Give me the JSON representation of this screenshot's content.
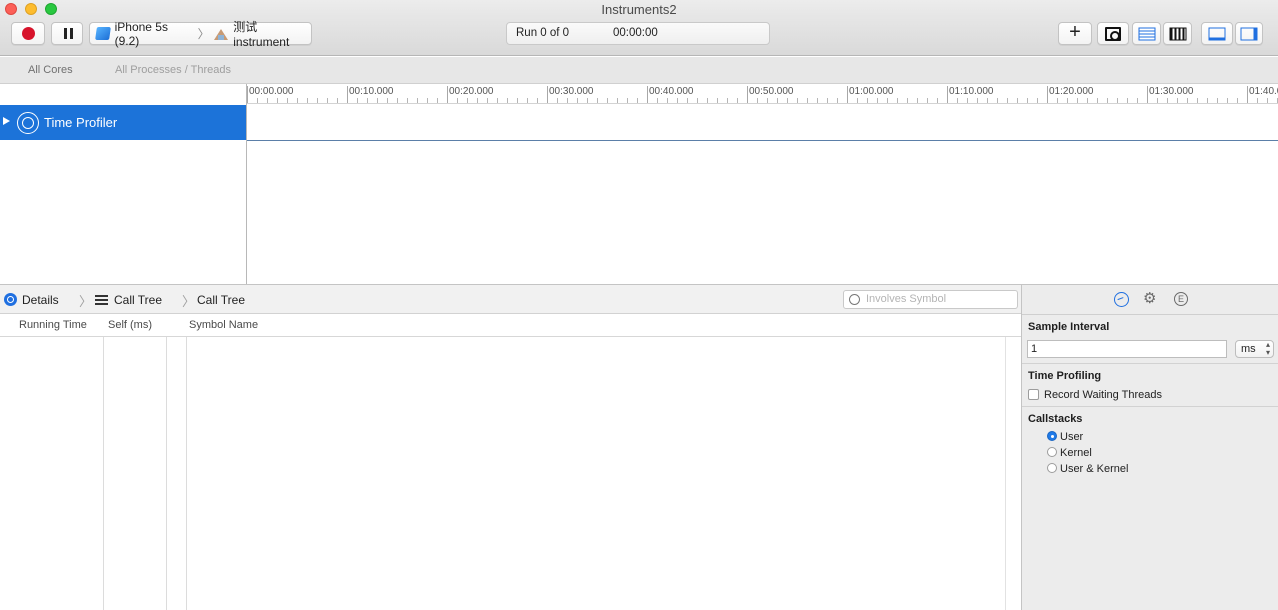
{
  "window": {
    "title": "Instruments2"
  },
  "toolbar": {
    "device": "iPhone 5s (9.2)",
    "target": "测试instrument",
    "run_label": "Run 0 of 0",
    "elapsed": "00:00:00",
    "add_label": "+"
  },
  "filter": {
    "cores": "All Cores",
    "processes": "All Processes / Threads"
  },
  "timeline": {
    "ticks": [
      "00:00.000",
      "00:10.000",
      "00:20.000",
      "00:30.000",
      "00:40.000",
      "00:50.000",
      "01:00.000",
      "01:10.000",
      "01:20.000",
      "01:30.000",
      "01:40.0"
    ],
    "track": {
      "name": "Time Profiler"
    }
  },
  "details": {
    "label": "Details",
    "path": [
      "Call Tree",
      "Call Tree"
    ],
    "search_placeholder": "Involves Symbol",
    "columns": [
      "Running Time",
      "Self (ms)",
      "Symbol Name"
    ]
  },
  "inspector": {
    "sample_interval_title": "Sample Interval",
    "sample_interval_value": "1",
    "sample_interval_unit": "ms",
    "time_profiling_title": "Time Profiling",
    "record_waiting_label": "Record Waiting Threads",
    "record_waiting_checked": false,
    "callstacks_title": "Callstacks",
    "callstack_options": [
      "User",
      "Kernel",
      "User & Kernel"
    ],
    "callstack_selected": "User",
    "extended_tab_glyph": "E",
    "settings_glyph": "⚙"
  },
  "colors": {
    "accent": "#1c73d9",
    "record": "#d7132b"
  }
}
